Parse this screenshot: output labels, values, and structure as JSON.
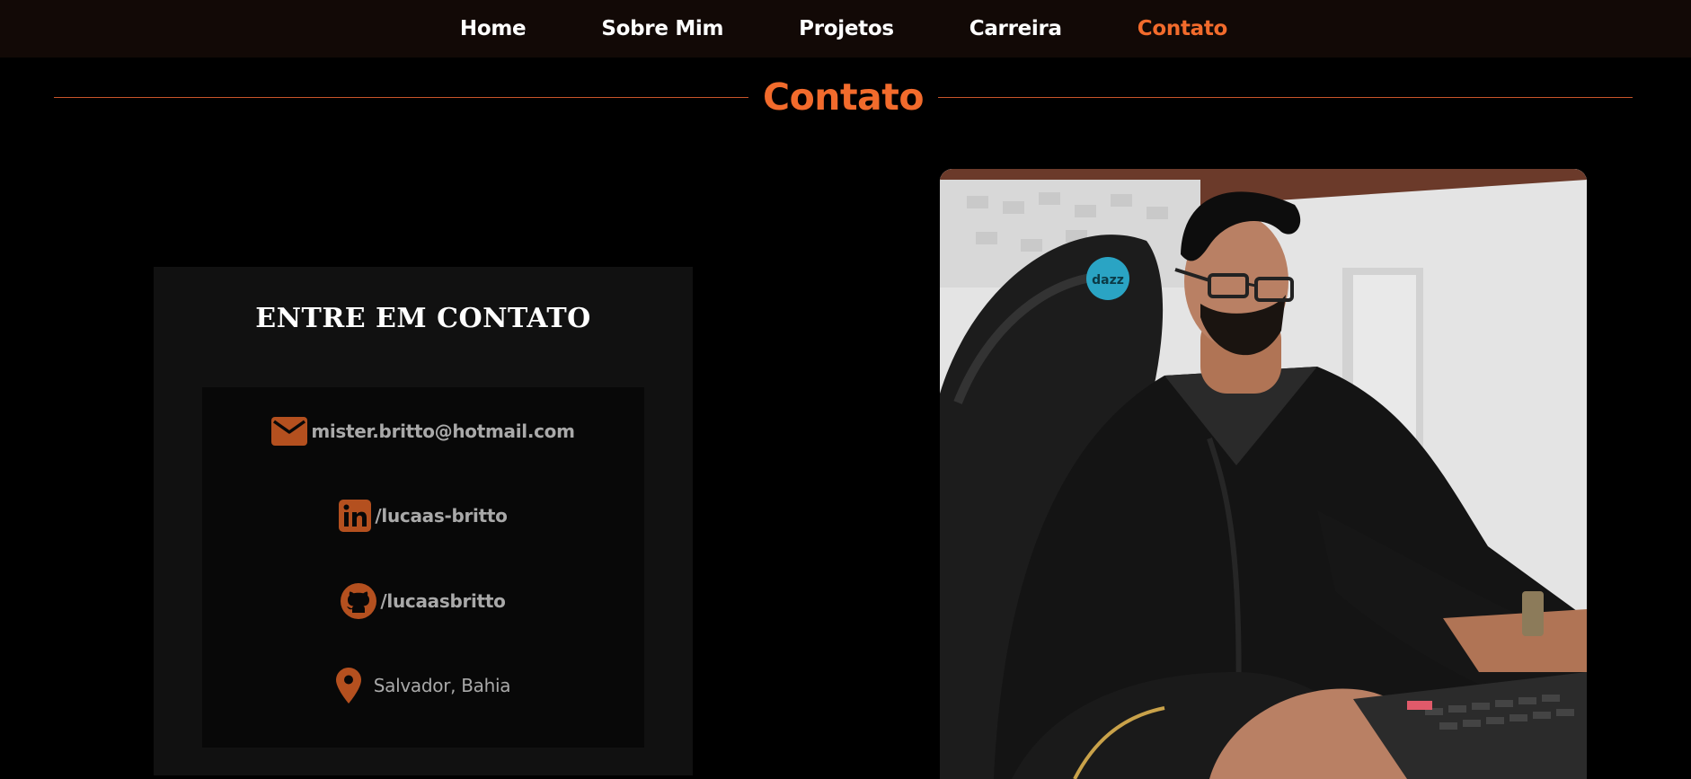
{
  "nav": {
    "items": [
      {
        "label": "Home",
        "active": false
      },
      {
        "label": "Sobre Mim",
        "active": false
      },
      {
        "label": "Projetos",
        "active": false
      },
      {
        "label": "Carreira",
        "active": false
      },
      {
        "label": "Contato",
        "active": true
      }
    ]
  },
  "section": {
    "title": "Contato"
  },
  "contact": {
    "heading": "ENTRE EM CONTATO",
    "items": [
      {
        "icon": "email-icon",
        "text": "mister.britto@hotmail.com"
      },
      {
        "icon": "linkedin-icon",
        "text": "/lucaas-britto"
      },
      {
        "icon": "github-icon",
        "text": "/lucaasbritto"
      },
      {
        "icon": "location-pin-icon",
        "text": "Salvador, Bahia"
      }
    ]
  },
  "photo": {
    "chair_sticker": "dazz"
  },
  "colors": {
    "accent": "#f26b2c",
    "icon": "#b4501f",
    "nav_bg": "#120906",
    "page_bg": "#000000",
    "card_bg": "#111111",
    "list_bg": "#080808",
    "muted_text": "#a9a9a9"
  }
}
